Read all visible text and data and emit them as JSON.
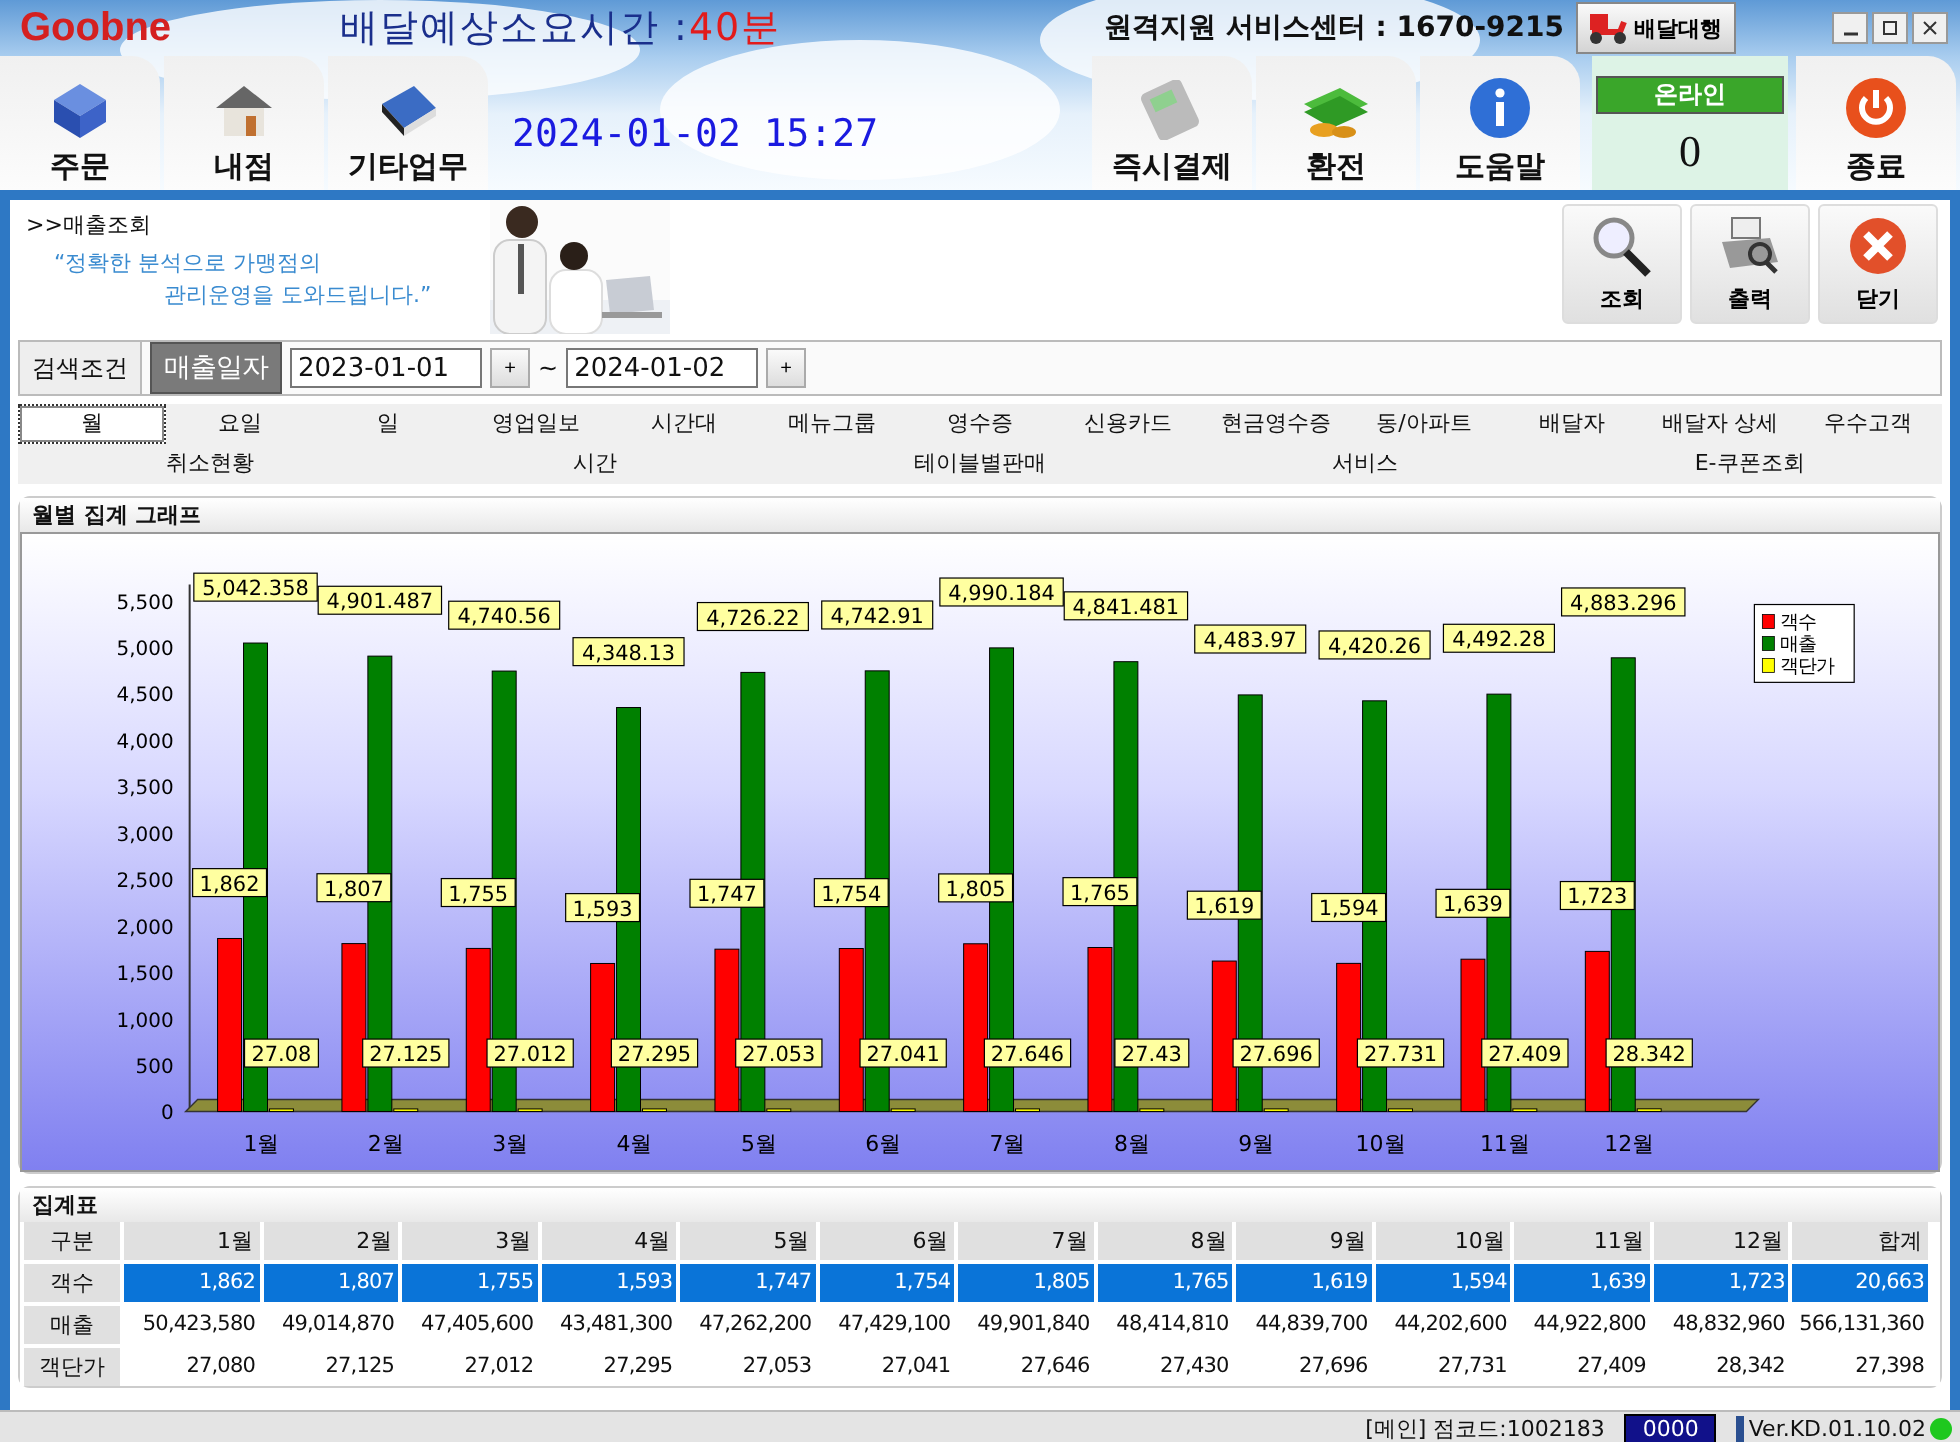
{
  "header": {
    "logo": "Goobne",
    "notice_label": "배달예상소요시간 :",
    "notice_value": "40분",
    "support": "원격지원 서비스센터 : 1670-9215",
    "delivery_button": "배달대행",
    "left_tabs": [
      "주문",
      "내점",
      "기타업무"
    ],
    "datetime": "2024-01-02 15:27",
    "right_tabs": [
      "즉시결제",
      "환전",
      "도움말"
    ],
    "online": {
      "label": "온라인",
      "count": "0"
    },
    "exit": "종료"
  },
  "page": {
    "breadcrumb": ">>매출조회",
    "slogan": [
      "“정확한 분석으로 가맹점의",
      "관리운영을 도와드립니다.”"
    ],
    "actions": [
      "조회",
      "출력",
      "닫기"
    ]
  },
  "search": {
    "label": "검색조건",
    "criterion": "매출일자",
    "from": "2023-01-01",
    "to": "2024-01-02",
    "separator": "~",
    "step": "+"
  },
  "tabs_row1": [
    {
      "label": "월",
      "selected": true
    },
    {
      "label": "요일",
      "selected": false
    },
    {
      "label": "일",
      "selected": false
    },
    {
      "label": "영업일보",
      "selected": false
    },
    {
      "label": "시간대",
      "selected": false
    },
    {
      "label": "메뉴그룹",
      "selected": false
    },
    {
      "label": "영수증",
      "selected": false
    },
    {
      "label": "신용카드",
      "selected": false
    },
    {
      "label": "현금영수증",
      "selected": false
    },
    {
      "label": "동/아파트",
      "selected": false
    },
    {
      "label": "배달자",
      "selected": false
    },
    {
      "label": "배달자 상세",
      "selected": false
    },
    {
      "label": "우수고객",
      "selected": false
    }
  ],
  "tabs_row2": [
    {
      "label": "취소현황",
      "selected": false
    },
    {
      "label": "시간",
      "selected": false
    },
    {
      "label": "테이블별판매",
      "selected": false
    },
    {
      "label": "서비스",
      "selected": false
    },
    {
      "label": "E-쿠폰조회",
      "selected": false
    }
  ],
  "chart_panel": {
    "title": "월별 집계 그래프",
    "chart_data": {
      "type": "bar",
      "categories": [
        "1월",
        "2월",
        "3월",
        "4월",
        "5월",
        "6월",
        "7월",
        "8월",
        "9월",
        "10월",
        "11월",
        "12월"
      ],
      "series": [
        {
          "name": "객수",
          "color": "#ff0000",
          "values": [
            1862,
            1807,
            1755,
            1593,
            1747,
            1754,
            1805,
            1765,
            1619,
            1594,
            1639,
            1723
          ],
          "value_labels": [
            "1,862",
            "1,807",
            "1,755",
            "1,593",
            "1,747",
            "1,754",
            "1,805",
            "1,765",
            "1,619",
            "1,594",
            "1,639",
            "1,723"
          ]
        },
        {
          "name": "매출",
          "color": "#008000",
          "values": [
            5042.358,
            4901.487,
            4740.56,
            4348.13,
            4726.22,
            4742.91,
            4990.184,
            4841.481,
            4483.97,
            4420.26,
            4492.28,
            4883.296
          ],
          "value_labels": [
            "5,042.358",
            "4,901.487",
            "4,740.56",
            "4,348.13",
            "4,726.22",
            "4,742.91",
            "4,990.184",
            "4,841.481",
            "4,483.97",
            "4,420.26",
            "4,492.28",
            "4,883.296"
          ]
        },
        {
          "name": "객단가",
          "color": "#ffff00",
          "values": [
            27.08,
            27.125,
            27.012,
            27.295,
            27.053,
            27.041,
            27.646,
            27.43,
            27.696,
            27.731,
            27.409,
            28.342
          ],
          "value_labels": [
            "27.08",
            "27.125",
            "27.012",
            "27.295",
            "27.053",
            "27.041",
            "27.646",
            "27.43",
            "27.696",
            "27.731",
            "27.409",
            "28.342"
          ]
        }
      ],
      "legend": "right",
      "ylim": [
        0,
        5500
      ],
      "yticks": [
        0,
        {
          "value": 500,
          "label": "500"
        },
        {
          "value": 1000,
          "label": "1,000"
        },
        {
          "value": 1500,
          "label": "1,500"
        },
        {
          "value": 2000,
          "label": "2,000"
        },
        {
          "value": 2500,
          "label": "2,500"
        },
        {
          "value": 3000,
          "label": "3,000"
        },
        {
          "value": 3500,
          "label": "3,500"
        },
        {
          "value": 4000,
          "label": "4,000"
        },
        {
          "value": 4500,
          "label": "4,500"
        },
        {
          "value": 5000,
          "label": "5,000"
        },
        {
          "value": 5500,
          "label": "5,500"
        }
      ]
    }
  },
  "table": {
    "title": "집계표",
    "columns": [
      "구분",
      "1월",
      "2월",
      "3월",
      "4월",
      "5월",
      "6월",
      "7월",
      "8월",
      "9월",
      "10월",
      "11월",
      "12월",
      "합계"
    ],
    "rows": [
      {
        "selected": true,
        "cells": [
          "객수",
          "1,862",
          "1,807",
          "1,755",
          "1,593",
          "1,747",
          "1,754",
          "1,805",
          "1,765",
          "1,619",
          "1,594",
          "1,639",
          "1,723",
          "20,663"
        ]
      },
      {
        "selected": false,
        "cells": [
          "매출",
          "50,423,580",
          "49,014,870",
          "47,405,600",
          "43,481,300",
          "47,262,200",
          "47,429,100",
          "49,901,840",
          "48,414,810",
          "44,839,700",
          "44,202,600",
          "44,922,800",
          "48,832,960",
          "566,131,360"
        ]
      },
      {
        "selected": false,
        "cells": [
          "객단가",
          "27,080",
          "27,125",
          "27,012",
          "27,295",
          "27,053",
          "27,041",
          "27,646",
          "27,430",
          "27,696",
          "27,731",
          "27,409",
          "28,342",
          "27,398"
        ]
      }
    ]
  },
  "status_bar": {
    "location": "[메인] 점코드:1002183",
    "code": "0000",
    "version": "Ver.KD.01.10.02"
  }
}
